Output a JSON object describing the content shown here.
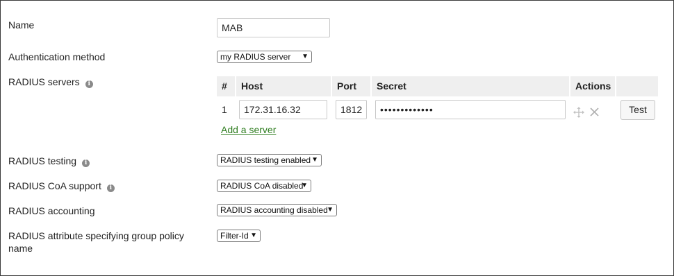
{
  "form": {
    "name_label": "Name",
    "name_value": "MAB",
    "auth_label": "Authentication method",
    "auth_value": "my RADIUS server",
    "servers_label": "RADIUS servers",
    "table": {
      "headers": [
        "#",
        "Host",
        "Port",
        "Secret",
        "Actions"
      ],
      "rows": [
        {
          "num": "1",
          "host": "172.31.16.32",
          "port": "1812",
          "secret": "•••••••••••••",
          "test_label": "Test"
        }
      ]
    },
    "add_server": "Add a server",
    "testing_label": "RADIUS testing",
    "testing_value": "RADIUS testing enabled",
    "coa_label": "RADIUS CoA support",
    "coa_value": "RADIUS CoA disabled",
    "accounting_label": "RADIUS accounting",
    "accounting_value": "RADIUS accounting disabled",
    "group_policy_label_line1": "RADIUS attribute specifying group policy",
    "group_policy_label_line2": "name",
    "group_policy_value": "Filter-Id"
  },
  "icons": {
    "info": "info-icon",
    "move": "move-icon",
    "close": "close-icon"
  },
  "colors": {
    "link": "#2e7d1f",
    "table_header_bg": "#efefef",
    "info_icon": "#8a8a8a"
  }
}
